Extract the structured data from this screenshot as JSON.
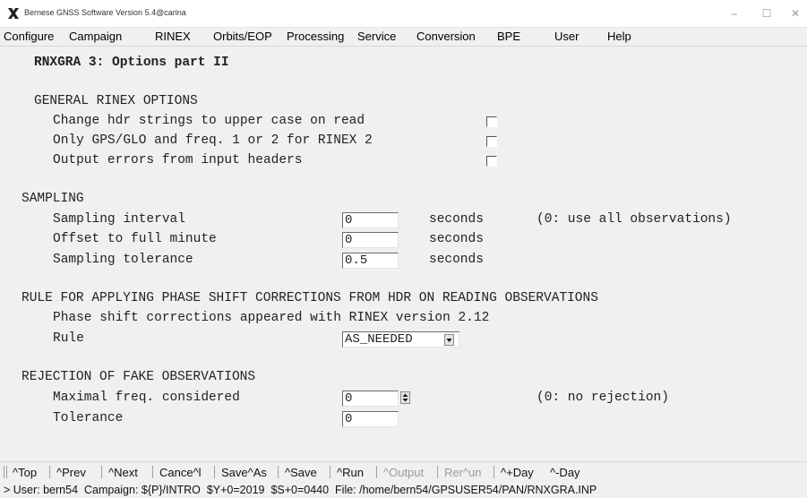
{
  "window": {
    "title": "Bernese GNSS Software Version 5.4@carina",
    "app_icon": "x-logo-icon",
    "minimize_glyph": "–",
    "maximize_glyph": "☐",
    "close_glyph": "✕"
  },
  "menu": [
    {
      "label": "Configure"
    },
    {
      "label": "Campaign"
    },
    {
      "label": "RINEX"
    },
    {
      "label": "Orbits/EOP"
    },
    {
      "label": "Processing"
    },
    {
      "label": "Service"
    },
    {
      "label": "Conversion"
    },
    {
      "label": "BPE"
    },
    {
      "label": "User"
    },
    {
      "label": "Help"
    }
  ],
  "panel": {
    "title": "RNXGRA 3: Options part II",
    "general": {
      "heading": "GENERAL RINEX OPTIONS",
      "opt1": "Change hdr strings to upper case on read",
      "opt2": "Only GPS/GLO and freq. 1 or 2 for RINEX 2",
      "opt3": "Output errors from input headers",
      "opt1_checked": false,
      "opt2_checked": false,
      "opt3_checked": false
    },
    "sampling": {
      "heading": "SAMPLING",
      "interval_label": "Sampling interval",
      "interval_value": "0",
      "offset_label": "Offset to full minute",
      "offset_value": "0",
      "tolerance_label": "Sampling tolerance",
      "tolerance_value": "0.5",
      "unit": "seconds",
      "interval_note": "(0: use all observations)"
    },
    "phase": {
      "heading": "RULE FOR APPLYING PHASE SHIFT CORRECTIONS FROM HDR ON READING OBSERVATIONS",
      "note": "Phase shift corrections appeared with RINEX version 2.12",
      "rule_label": "Rule",
      "rule_value": "AS_NEEDED"
    },
    "rejection": {
      "heading": "REJECTION OF FAKE OBSERVATIONS",
      "maxfreq_label": "Maximal freq. considered",
      "maxfreq_value": "0",
      "maxfreq_note": "(0: no rejection)",
      "tolerance_label": "Tolerance",
      "tolerance_value": "0"
    }
  },
  "toolbar": {
    "top": "^Top",
    "prev": "^Prev",
    "next": "^Next",
    "cancel": "Cance^l",
    "saveas": "Save^As",
    "save": "^Save",
    "run": "^Run",
    "output": "^Output",
    "rerun": "Rer^un",
    "plusday": "^+Day",
    "minusday": "^-Day"
  },
  "status": "> User: bern54  Campaign: ${P}/INTRO  $Y+0=2019  $S+0=0440  File: /home/bern54/GPSUSER54/PAN/RNXGRA.INP"
}
